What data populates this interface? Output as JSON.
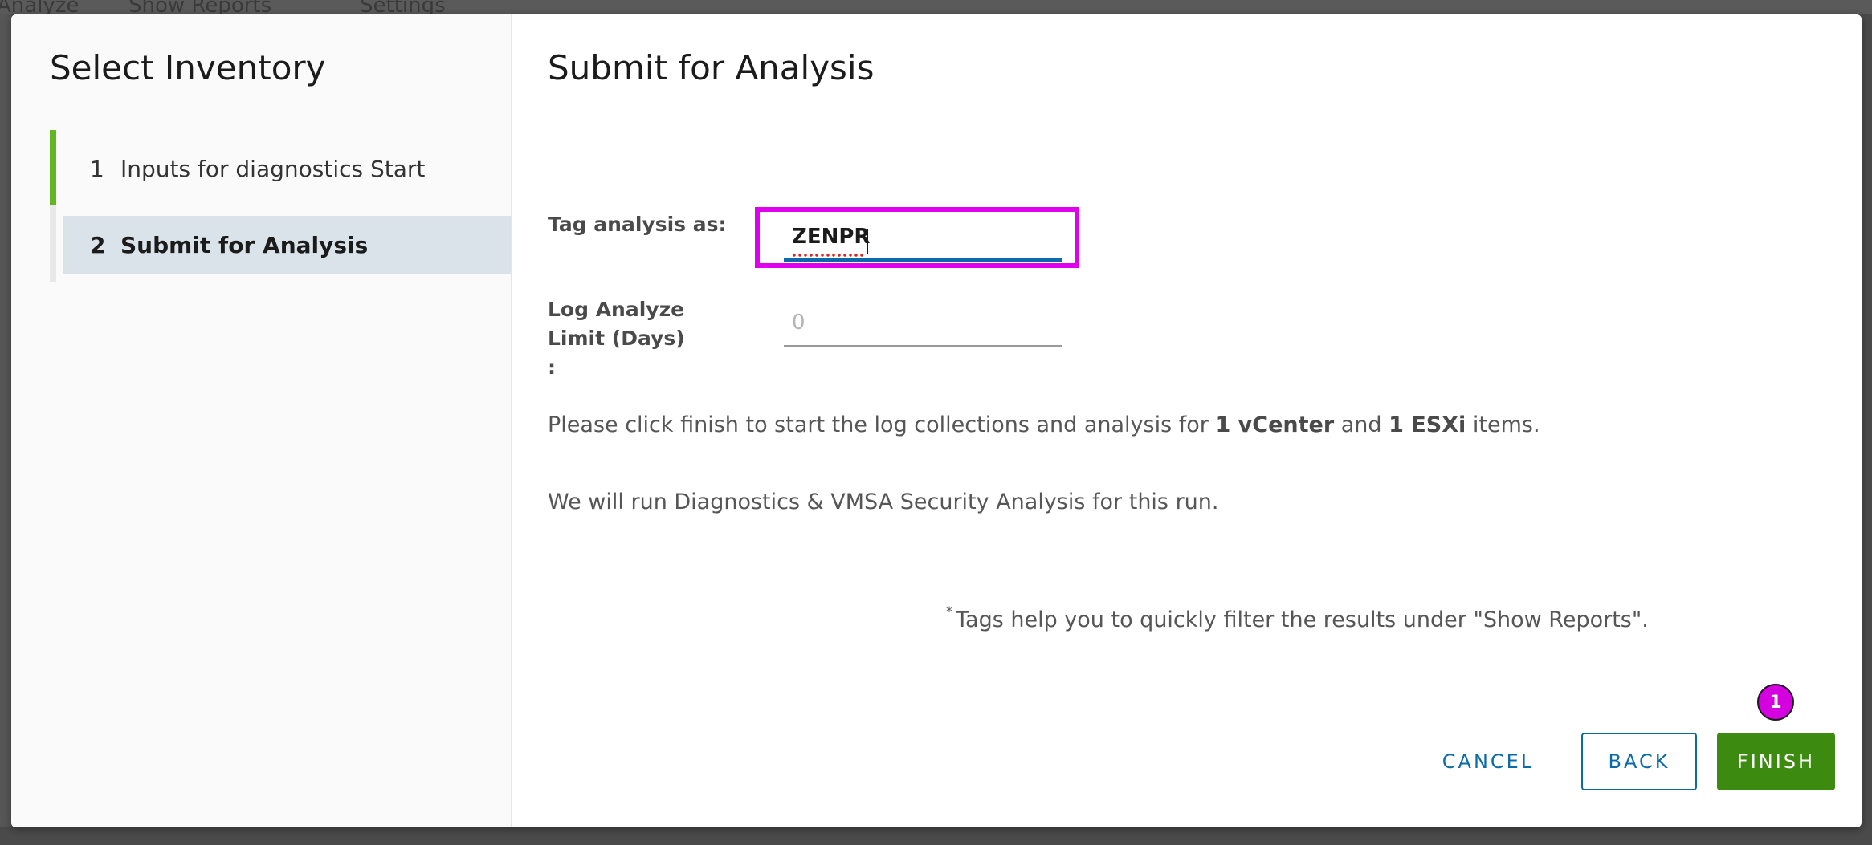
{
  "background": {
    "tabs": [
      "Analyze",
      "Show Reports",
      "Settings"
    ]
  },
  "stepnav": {
    "title": "Select Inventory",
    "steps": [
      {
        "number": "1",
        "label": "Inputs for diagnostics Start",
        "state": "completed"
      },
      {
        "number": "2",
        "label": "Submit for Analysis",
        "state": "active"
      }
    ]
  },
  "main": {
    "title": "Submit for Analysis",
    "tag_label": "Tag analysis as:",
    "tag_value": "ZENPR",
    "log_label": "Log Analyze Limit (Days) :",
    "log_placeholder": "0",
    "info": {
      "prefix": "Please click finish to start the log collections and analysis for",
      "vcenter": "1 vCenter",
      "and": "and",
      "esxi": "1 ESXi",
      "suffix": "items."
    },
    "run_text": "We will run Diagnostics & VMSA Security Analysis for this run.",
    "footnote_marker": "*",
    "footnote": "Tags help you to quickly filter the results under \"Show Reports\"."
  },
  "buttons": {
    "cancel": "CANCEL",
    "back": "BACK",
    "finish": "FINISH"
  },
  "annotation": {
    "badge": "1"
  },
  "colors": {
    "accent": "#0b6ba8",
    "finish": "#3d8a10",
    "progress": "#62b623",
    "highlight": "#e000ee"
  }
}
